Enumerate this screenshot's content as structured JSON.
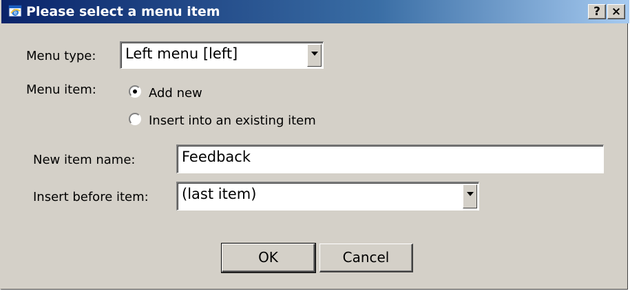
{
  "window": {
    "title": "Please select a menu item",
    "help_label": "?",
    "close_label": "×"
  },
  "form": {
    "menu_type_label": "Menu type:",
    "menu_type_value": "Left menu [left]",
    "menu_item_label": "Menu item:",
    "radio_add_new": "Add new",
    "radio_insert_existing": "Insert into an existing item",
    "selected_radio": "Add new",
    "new_item_name_label": "New item name:",
    "new_item_name_value": "Feedback",
    "insert_before_label": "Insert before item:",
    "insert_before_value": "(last item)"
  },
  "buttons": {
    "ok": "OK",
    "cancel": "Cancel"
  },
  "colors": {
    "dialog_bg": "#d4d0c8",
    "title_gradient_start": "#0a246a",
    "title_gradient_end": "#a6caf0"
  },
  "icons": {
    "app": "ie-app-icon",
    "dropdown": "chevron-down-icon"
  }
}
